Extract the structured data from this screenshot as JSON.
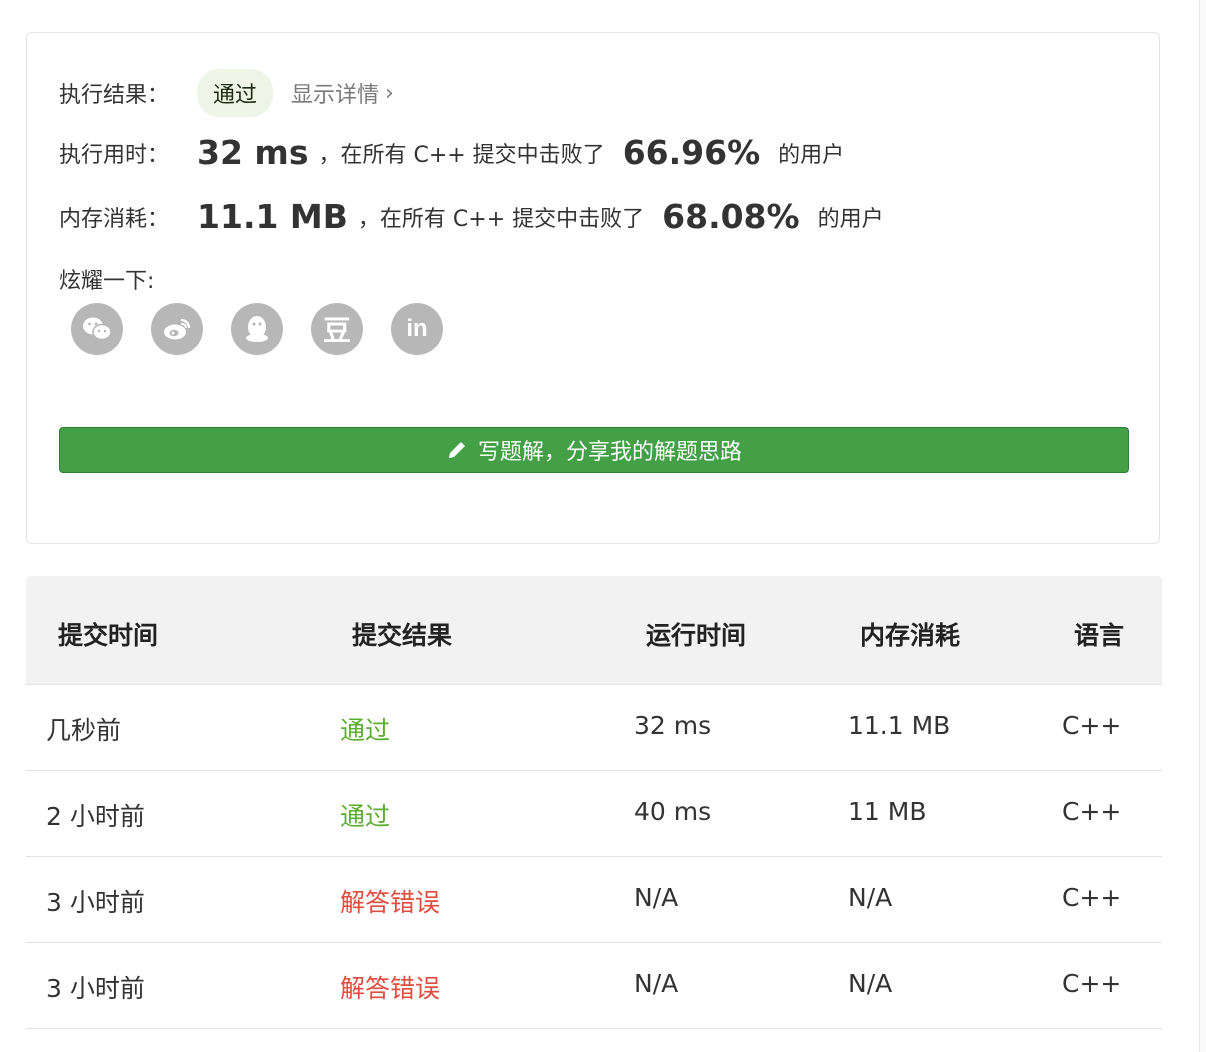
{
  "result": {
    "label": "执行结果：",
    "status": "通过",
    "details_link": "显示详情",
    "details_chevron": "›"
  },
  "runtime": {
    "label": "执行用时：",
    "value": "32 ms",
    "middle": "，在所有 C++ 提交中击败了",
    "percent": "66.96%",
    "tail": "的用户"
  },
  "memory": {
    "label": "内存消耗：",
    "value": "11.1 MB",
    "middle": "，在所有 C++ 提交中击败了",
    "percent": "68.08%",
    "tail": "的用户"
  },
  "share": {
    "label": "炫耀一下:",
    "icons": [
      "wechat-icon",
      "weibo-icon",
      "qq-icon",
      "douban-icon",
      "linkedin-icon"
    ],
    "douban_glyph": "豆",
    "linkedin_glyph": "in"
  },
  "write_solution": {
    "label": "写题解，分享我的解题思路",
    "icon": "pencil-icon"
  },
  "colors": {
    "accepted": "#5cae2f",
    "wrong": "#e04c3e",
    "button": "#43a047"
  },
  "table": {
    "headers": [
      "提交时间",
      "提交结果",
      "运行时间",
      "内存消耗",
      "语言"
    ],
    "rows": [
      {
        "time": "几秒前",
        "result": "通过",
        "runtime": "32 ms",
        "memory": "11.1 MB",
        "lang": "C++"
      },
      {
        "time": "2 小时前",
        "result": "通过",
        "runtime": "40 ms",
        "memory": "11 MB",
        "lang": "C++"
      },
      {
        "time": "3 小时前",
        "result": "解答错误",
        "runtime": "N/A",
        "memory": "N/A",
        "lang": "C++"
      },
      {
        "time": "3 小时前",
        "result": "解答错误",
        "runtime": "N/A",
        "memory": "N/A",
        "lang": "C++"
      }
    ]
  }
}
